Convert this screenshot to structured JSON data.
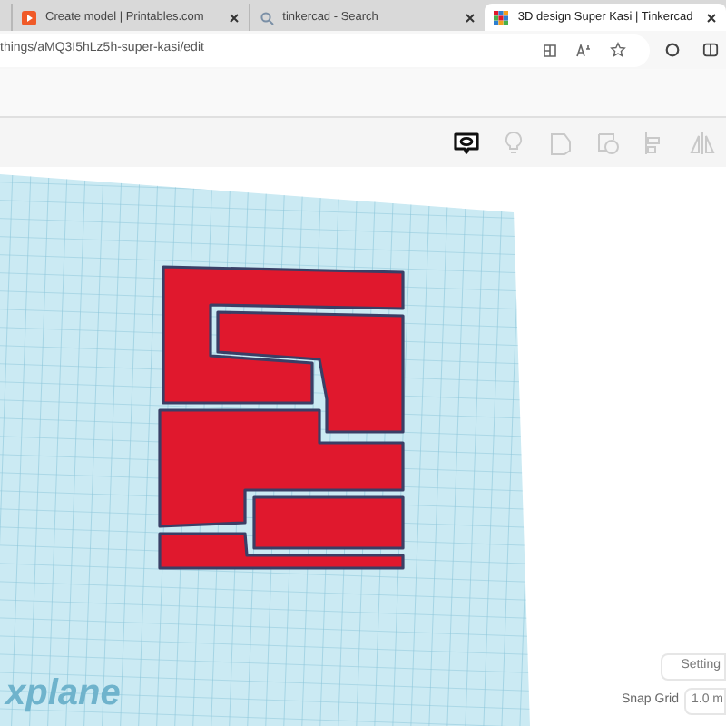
{
  "tabs": [
    {
      "title": "Create model | Printables.com",
      "kind": "printables",
      "selected": false
    },
    {
      "title": "tinkercad - Search",
      "kind": "search",
      "selected": false
    },
    {
      "title": "3D design Super Kasi | Tinkercad",
      "kind": "tinkercad",
      "selected": true
    }
  ],
  "address": "things/aMQ3I5hLz5h-super-kasi/edit",
  "toolbar": [
    {
      "kind": "comment",
      "active": true
    },
    {
      "kind": "bulb",
      "active": false
    },
    {
      "kind": "shape",
      "active": false
    },
    {
      "kind": "shapes",
      "active": false
    },
    {
      "kind": "align",
      "active": false
    },
    {
      "kind": "mirror",
      "active": false
    }
  ],
  "workplane_label": "xplane",
  "settings_button": "Setting",
  "snap_grid": {
    "label": "Snap Grid",
    "value": "1.0 m"
  }
}
